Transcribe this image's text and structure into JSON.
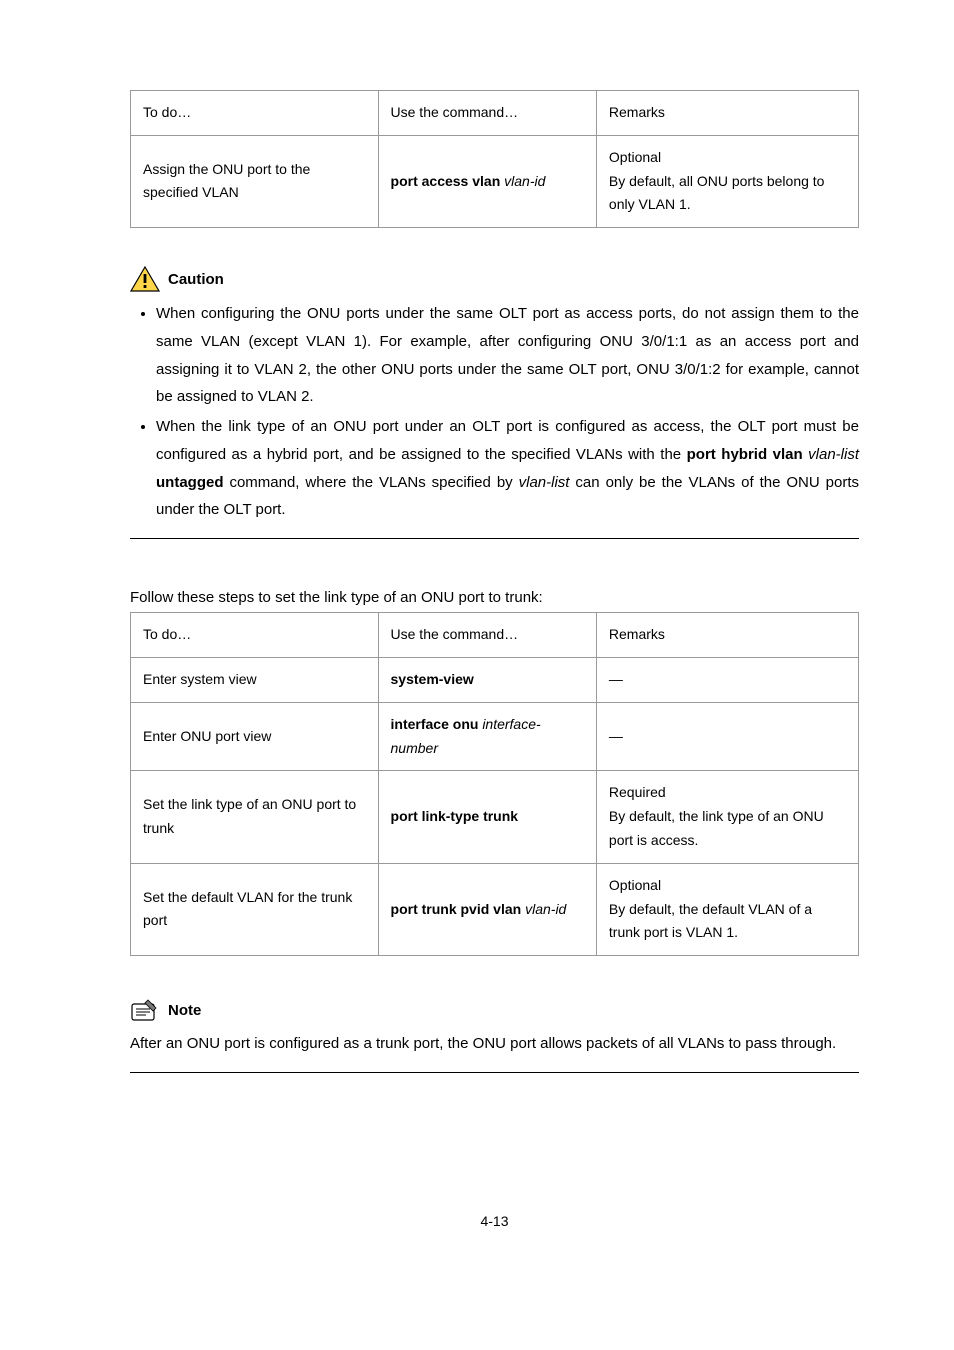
{
  "table1": {
    "h1": "To do…",
    "h2": "Use the command…",
    "h3": "Remarks",
    "r1c1": "Assign the ONU port to the specified VLAN",
    "r1c2_a": "port access vlan",
    "r1c2_b": "vlan-id",
    "r1c3_a": "Optional",
    "r1c3_b": "By default, all ONU ports belong to only VLAN 1."
  },
  "caution": {
    "title": "Caution",
    "b1": "When configuring the ONU ports under the same OLT port as access ports, do not assign them to the same VLAN (except VLAN 1). For example, after configuring ONU 3/0/1:1 as an access port and assigning it to VLAN 2, the other ONU ports under the same OLT port, ONU 3/0/1:2 for example, cannot be assigned to VLAN 2.",
    "b2a": "When the link type of an ONU port under an OLT port is configured as access, the OLT port must be configured as a hybrid port, and be assigned to the specified VLANs with the ",
    "b2_cmd1": "port hybrid vlan",
    "b2_i1": "vlan-list",
    "b2_cmd2": "untagged",
    "b2b": " command, where the VLANs specified by ",
    "b2_i2": "vlan-list",
    "b2c": " can only be the VLANs of the ONU ports under the OLT port."
  },
  "lead": "Follow these steps to set the link type of an ONU port to trunk:",
  "table2": {
    "h1": "To do…",
    "h2": "Use the command…",
    "h3": "Remarks",
    "r1c1": "Enter system view",
    "r1c2": "system-view",
    "r1c3": "—",
    "r2c1": "Enter ONU port view",
    "r2c2a": "interface onu",
    "r2c2b": "interface-number",
    "r2c3": "—",
    "r3c1": "Set the link type of an ONU port to trunk",
    "r3c2": "port link-type trunk",
    "r3c3a": "Required",
    "r3c3b": "By default, the link type of an ONU port is access.",
    "r4c1": "Set the default VLAN for the trunk port",
    "r4c2a": "port trunk pvid vlan",
    "r4c2b": "vlan-id",
    "r4c3a": "Optional",
    "r4c3b": "By default, the default VLAN of a trunk port is VLAN 1."
  },
  "note": {
    "title": "Note",
    "body": "After an ONU port is configured as a trunk port, the ONU port allows packets of all VLANs to pass through."
  },
  "pagenum": "4-13"
}
